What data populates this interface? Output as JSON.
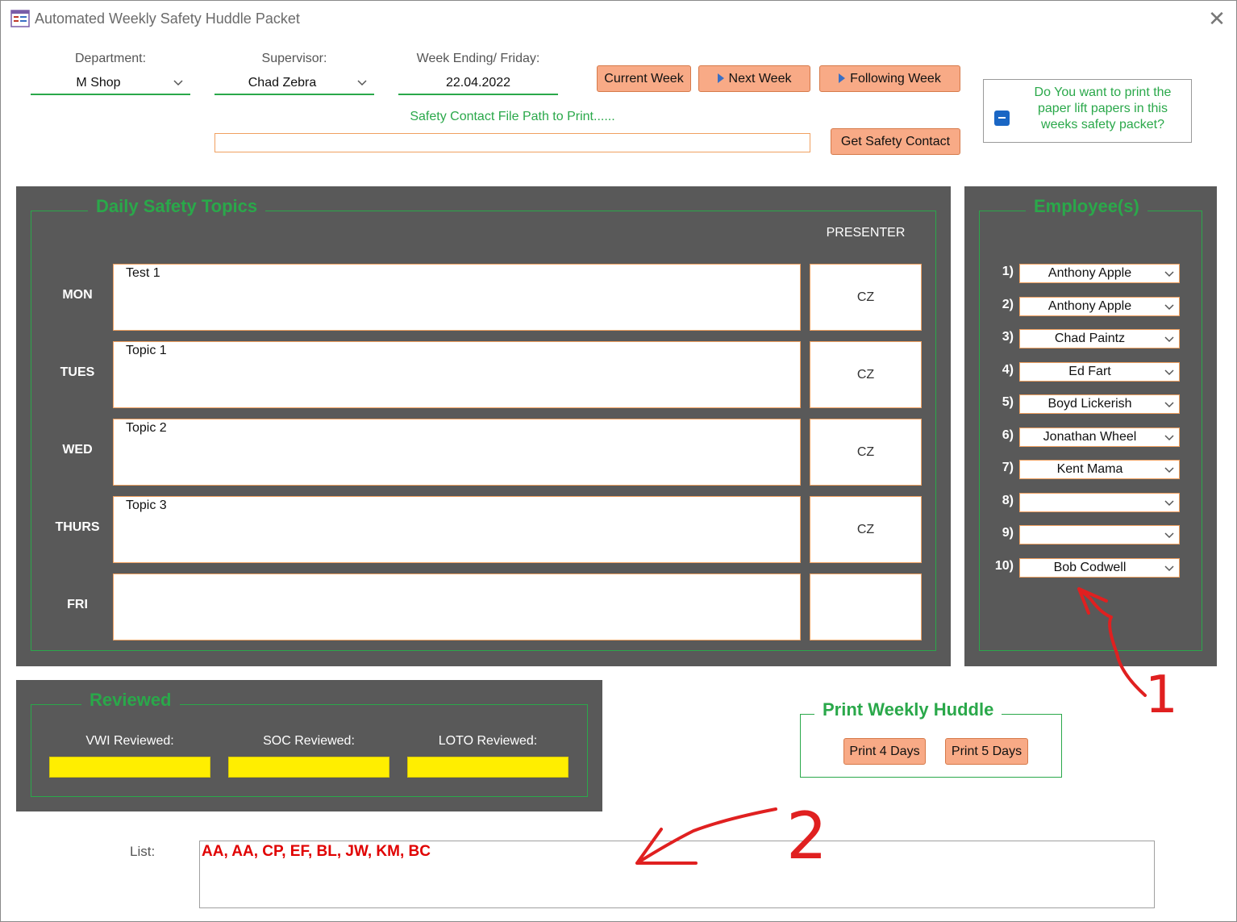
{
  "window": {
    "title": "Automated Weekly Safety Huddle Packet",
    "icon": "form-icon",
    "close_icon": "close-icon"
  },
  "header": {
    "department_label": "Department:",
    "department_value": "M  Shop",
    "supervisor_label": "Supervisor:",
    "supervisor_value": "Chad Zebra",
    "week_label": "Week Ending/ Friday:",
    "week_value": "22.04.2022",
    "current_week_button": "Current Week",
    "next_week_button": "Next Week",
    "following_week_button": "Following Week",
    "safety_path_label": "Safety Contact File Path to Print......",
    "safety_path_value": "",
    "get_safety_contact_button": "Get Safety Contact",
    "print_question": "Do You want to print the paper lift papers in this weeks safety packet?"
  },
  "daily_topics": {
    "title": "Daily Safety Topics",
    "presenter_header": "PRESENTER",
    "days": [
      {
        "day": "MON",
        "topic": "Test 1",
        "presenter": "CZ"
      },
      {
        "day": "TUES",
        "topic": "Topic 1",
        "presenter": "CZ"
      },
      {
        "day": "WED",
        "topic": "Topic 2",
        "presenter": "CZ"
      },
      {
        "day": "THURS",
        "topic": "Topic 3",
        "presenter": "CZ"
      },
      {
        "day": "FRI",
        "topic": "",
        "presenter": ""
      }
    ]
  },
  "employees": {
    "title": "Employee(s)",
    "list": [
      {
        "num": "1)",
        "name": "Anthony Apple"
      },
      {
        "num": "2)",
        "name": "Anthony Apple"
      },
      {
        "num": "3)",
        "name": "Chad Paintz"
      },
      {
        "num": "4)",
        "name": "Ed Fart"
      },
      {
        "num": "5)",
        "name": "Boyd Lickerish"
      },
      {
        "num": "6)",
        "name": "Jonathan Wheel"
      },
      {
        "num": "7)",
        "name": "Kent Mama"
      },
      {
        "num": "8)",
        "name": ""
      },
      {
        "num": "9)",
        "name": ""
      },
      {
        "num": "10)",
        "name": "Bob Codwell"
      }
    ]
  },
  "reviewed": {
    "title": "Reviewed",
    "vwi_label": "VWI Reviewed:",
    "soc_label": "SOC Reviewed:",
    "loto_label": "LOTO Reviewed:"
  },
  "print": {
    "title": "Print Weekly Huddle",
    "print4_button": "Print 4 Days",
    "print5_button": "Print 5 Days"
  },
  "list": {
    "label": "List:",
    "value": "AA, AA, CP, EF, BL, JW, KM, BC"
  },
  "annotations": {
    "marker1": "1",
    "marker2": "2"
  },
  "colors": {
    "accent_green": "#2aa84a",
    "panel_gray": "#595959",
    "button_orange": "#f8aa86",
    "highlight_yellow": "#ffee00",
    "list_red": "#e00000"
  }
}
